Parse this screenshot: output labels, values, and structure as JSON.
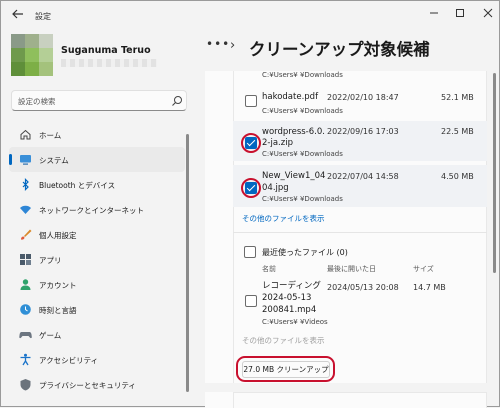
{
  "window": {
    "title": "設定"
  },
  "profile": {
    "name": "Suganuma Teruo"
  },
  "search": {
    "placeholder": "設定の検索"
  },
  "sidebar": {
    "items": [
      {
        "label": "ホーム",
        "icon": "home-icon"
      },
      {
        "label": "システム",
        "icon": "system-monitor-icon",
        "active": true
      },
      {
        "label": "Bluetooth とデバイス",
        "icon": "bluetooth-icon"
      },
      {
        "label": "ネットワークとインターネット",
        "icon": "network-wifi-icon"
      },
      {
        "label": "個人用設定",
        "icon": "paintbrush-icon"
      },
      {
        "label": "アプリ",
        "icon": "apps-icon"
      },
      {
        "label": "アカウント",
        "icon": "account-icon"
      },
      {
        "label": "時刻と言語",
        "icon": "time-language-icon"
      },
      {
        "label": "ゲーム",
        "icon": "gamepad-icon"
      },
      {
        "label": "アクセシビリティ",
        "icon": "accessibility-icon"
      },
      {
        "label": "プライバシーとセキュリティ",
        "icon": "shield-icon"
      }
    ]
  },
  "header": {
    "more": "•••",
    "title": "クリーンアップ対象候補"
  },
  "downloads": {
    "top_path": "C:¥Users¥  ¥Downloads",
    "files": [
      {
        "name": "hakodate.pdf",
        "date": "2022/02/10 18:47",
        "size": "52.1 MB",
        "path": "C:¥Users¥  ¥Downloads",
        "checked": false
      },
      {
        "name": "wordpress-6.0.2-ja.zip",
        "name_l1": "wordpress-6.0.",
        "name_l2": "2-ja.zip",
        "date": "2022/09/16 17:03",
        "size": "22.5 MB",
        "path": "C:¥Users¥  ¥Downloads",
        "checked": true
      },
      {
        "name": "New_View1_0404.jpg",
        "name_l1": "New_View1_04",
        "name_l2": "04.jpg",
        "date": "2022/07/04 14:58",
        "size": "4.50 MB",
        "path": "C:¥Users¥  ¥Downloads",
        "checked": true
      }
    ],
    "show_more": "その他のファイルを表示"
  },
  "recent": {
    "label": "最近使ったファイル (0)",
    "columns": {
      "name": "名前",
      "modified": "最後に開いた日",
      "size": "サイズ"
    },
    "file": {
      "name_l1": "レコーディング",
      "name_l2": "2024-05-13",
      "name_l3": "200841.mp4",
      "date": "2024/05/13 20:08",
      "size": "14.7 MB",
      "path": "C:¥Users¥  ¥Videos"
    },
    "show_more": "その他のファイルを表示"
  },
  "cleanup": {
    "label": "27.0 MB クリーンアップ"
  },
  "colors": {
    "accent": "#0067c0",
    "highlight_ring": "#c8102e"
  }
}
